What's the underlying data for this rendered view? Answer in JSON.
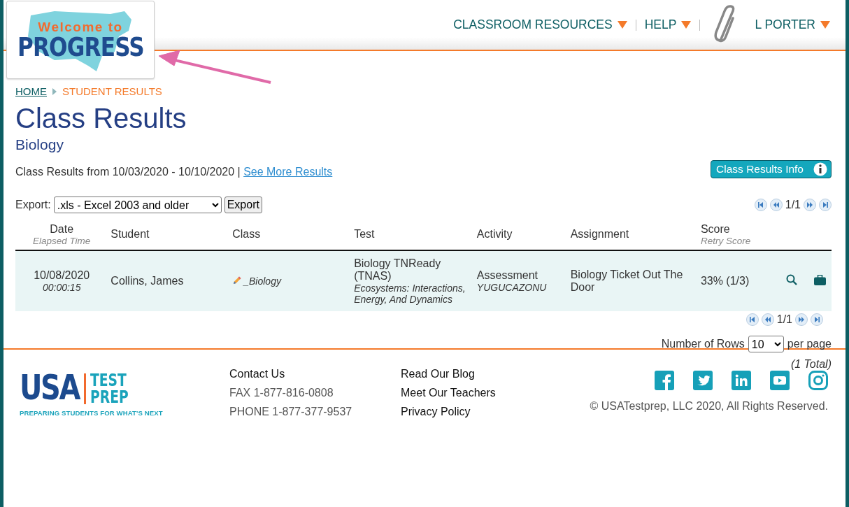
{
  "header": {
    "logo": {
      "line_1": "Welcome to",
      "line_2": "PROGRESS"
    },
    "nav": [
      {
        "label": "CLASSROOM RESOURCES",
        "kind": "menu"
      },
      {
        "label": "HELP",
        "kind": "menu"
      },
      {
        "label": "L PORTER",
        "kind": "user"
      }
    ]
  },
  "breadcrumb": [
    {
      "label": "HOME",
      "kind": "link"
    },
    {
      "label": "STUDENT RESULTS",
      "kind": "current"
    }
  ],
  "title": "Class Results",
  "subtitle": "Biology",
  "range": {
    "text": "Class Results from 10/03/2020 - 10/10/2020 |",
    "link": "See More Results"
  },
  "info_button": "Class Results Info",
  "export": {
    "label": "Export:",
    "format": ".xls - Excel 2003 and older",
    "button": "Export"
  },
  "pager_top": "1/1",
  "table": {
    "columns": [
      {
        "label": "Date",
        "sublabel": "Elapsed Time"
      },
      {
        "label": "Student"
      },
      {
        "label": "Class"
      },
      {
        "label": "Test"
      },
      {
        "label": "Activity"
      },
      {
        "label": "Assignment"
      },
      {
        "label": "Score",
        "sublabel": "Retry Score"
      }
    ],
    "rows": [
      {
        "date": "10/08/2020",
        "elapsed": "00:00:15",
        "student": "Collins, James",
        "class": "_Biology",
        "test": "Biology TNReady (TNAS)",
        "test_detail": "Ecosystems: Interactions, Energy, And Dynamics",
        "activity": "Assessment",
        "activity_code": "YUGUCAZONU",
        "assignment": "Biology Ticket Out The Door",
        "score": "33% (1/3)"
      }
    ]
  },
  "pager_bottom": "1/1",
  "rows_per_page": {
    "label": "Number of Rows",
    "value": "10",
    "suffix": "per page"
  },
  "total": "(1 Total)",
  "footer": {
    "logo": {
      "word": "USA",
      "line_1": "TEST",
      "line_2": "PREP",
      "tagline": "PREPARING STUDENTS FOR WHAT'S NEXT"
    },
    "contact": [
      {
        "label": "Contact Us",
        "kind": "link"
      },
      {
        "label": "FAX 1-877-816-0808",
        "kind": "text"
      },
      {
        "label": "PHONE 1-877-377-9537",
        "kind": "text"
      }
    ],
    "links": [
      "Read Our Blog",
      "Meet Our Teachers",
      "Privacy Policy"
    ],
    "social": [
      {
        "kind": "facebook"
      },
      {
        "kind": "twitter"
      },
      {
        "kind": "linkedin"
      },
      {
        "kind": "youtube"
      },
      {
        "kind": "instagram"
      }
    ],
    "copyright": "© USATestprep, LLC 2020, All Rights Reserved."
  }
}
